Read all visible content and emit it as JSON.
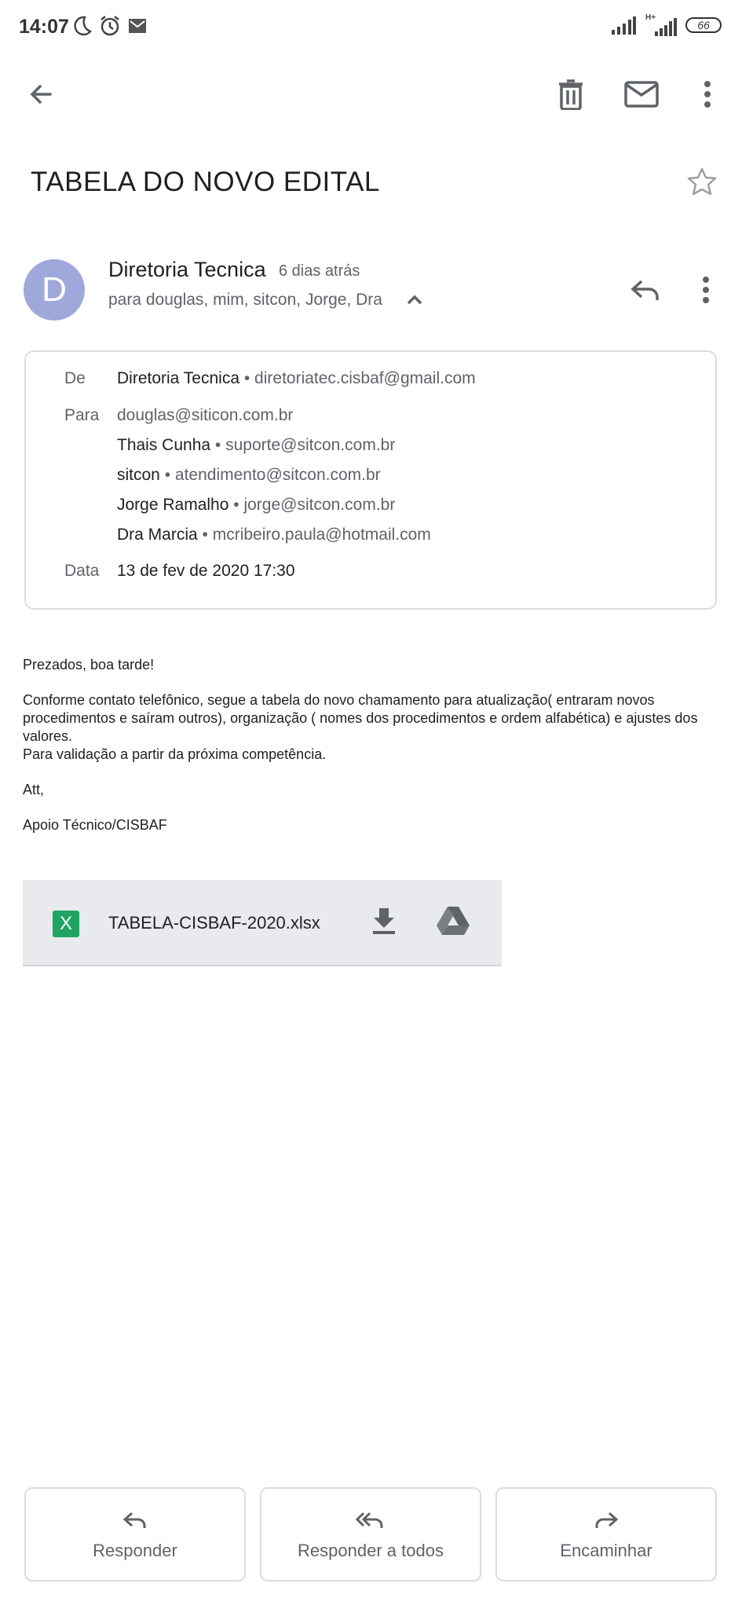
{
  "status_bar": {
    "time": "14:07",
    "icons": [
      "moon-icon",
      "alarm-icon",
      "gmail-notification-icon",
      "signal-icon",
      "hplus-signal-icon",
      "battery-icon"
    ],
    "network_label": "H+",
    "battery": "66"
  },
  "toolbar": {
    "icons": [
      "back-arrow-icon",
      "trash-icon",
      "mail-icon",
      "more-vert-icon"
    ]
  },
  "email": {
    "subject": "TABELA DO NOVO EDITAL",
    "sender": {
      "avatar_letter": "D",
      "avatar_color": "#9fa8da",
      "name": "Diretoria Tecnica",
      "time": "6 dias atrás",
      "recipients_summary": "para douglas, mim, sitcon, Jorge, Dra"
    },
    "details": {
      "from_label": "De",
      "from_name": "Diretoria Tecnica",
      "from_email": "diretoriatec.cisbaf@gmail.com",
      "to_label": "Para",
      "recipients": [
        {
          "name": "",
          "email": "douglas@siticon.com.br"
        },
        {
          "name": "Thais Cunha",
          "email": "suporte@sitcon.com.br"
        },
        {
          "name": "sitcon",
          "email": "atendimento@sitcon.com.br"
        },
        {
          "name": "Jorge Ramalho",
          "email": "jorge@sitcon.com.br"
        },
        {
          "name": "Dra Marcia",
          "email": "mcribeiro.paula@hotmail.com"
        }
      ],
      "date_label": "Data",
      "date_value": "13 de fev de 2020 17:30"
    },
    "body": {
      "greeting": "Prezados, boa tarde!",
      "paragraph": "Conforme contato telefônico, segue a tabela do novo chamamento para atualização( entraram novos procedimentos e saíram outros), organização ( nomes dos procedimentos e ordem alfabética)  e ajustes dos valores.",
      "line2": "Para validação a partir da próxima competência.",
      "closing": "Att,",
      "signature": "Apoio Técnico/CISBAF"
    },
    "attachment": {
      "file_icon_letter": "X",
      "file_icon_color": "#1fa463",
      "filename": "TABELA-CISBAF-2020.xlsx"
    }
  },
  "actions": {
    "reply": "Responder",
    "reply_all": "Responder a todos",
    "forward": "Encaminhar"
  }
}
